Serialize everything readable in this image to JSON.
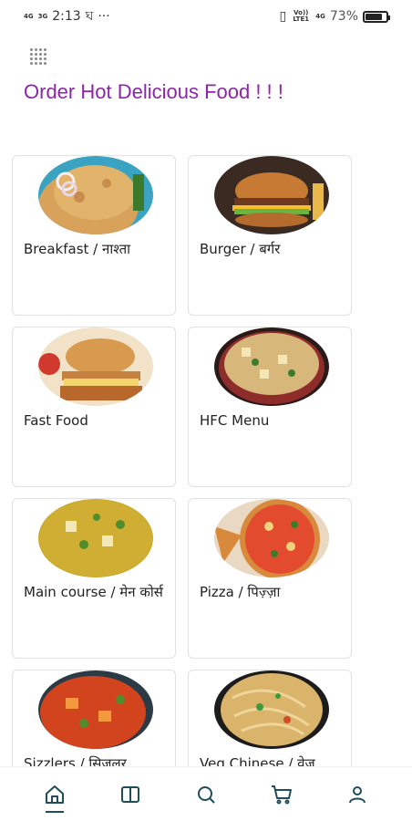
{
  "status": {
    "net1": "4G",
    "net2": "3G",
    "time": "2:13",
    "carrier_glyph": "ঘ",
    "dots": "···",
    "vibrate_glyph": "▯",
    "volte": "Vo)) LTE1",
    "net3": "4G",
    "battery": "73%",
    "battery_level": 0.73
  },
  "header": {
    "menu_icon": "grid-dots-icon",
    "title": "Order Hot Delicious Food ! ! !"
  },
  "colors": {
    "title": "#8e24aa",
    "nav_icon": "#1f4e5a",
    "card_border": "#e2e2e2"
  },
  "categories": [
    {
      "label": "Breakfast / नाश्ता",
      "icon": "paratha-photo"
    },
    {
      "label": "Burger / बर्गर",
      "icon": "burger-photo"
    },
    {
      "label": "Fast Food",
      "icon": "sandwich-photo"
    },
    {
      "label": "HFC Menu",
      "icon": "rice-photo"
    },
    {
      "label": "Main course / मेन कोर्स",
      "icon": "curry-photo"
    },
    {
      "label": "Pizza / पिज़्ज़ा",
      "icon": "pizza-photo"
    },
    {
      "label": "Sizzlers / सिज़लर",
      "icon": "sizzler-photo"
    },
    {
      "label": "Veg Chinese / वेज",
      "icon": "noodles-photo"
    }
  ],
  "bottom_nav": [
    {
      "name": "home",
      "icon": "home-icon",
      "active": true
    },
    {
      "name": "menu",
      "icon": "book-icon",
      "active": false
    },
    {
      "name": "search",
      "icon": "search-icon",
      "active": false
    },
    {
      "name": "cart",
      "icon": "cart-icon",
      "active": false
    },
    {
      "name": "account",
      "icon": "user-icon",
      "active": false
    }
  ]
}
